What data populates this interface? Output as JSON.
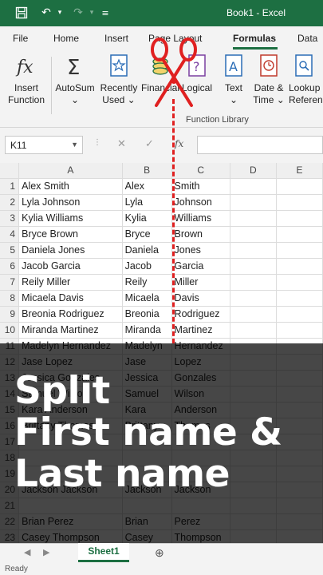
{
  "title_bar": {
    "title": "Book1  -  Excel"
  },
  "tabs": [
    {
      "label": "File",
      "active": false
    },
    {
      "label": "Home",
      "active": false
    },
    {
      "label": "Insert",
      "active": false
    },
    {
      "label": "Page Layout",
      "active": false
    },
    {
      "label": "Formulas",
      "active": true
    },
    {
      "label": "Data",
      "active": false
    }
  ],
  "ribbon": {
    "buttons": [
      {
        "line1": "Insert",
        "line2": "Function",
        "icon": "fx-icon"
      },
      {
        "line1": "AutoSum",
        "line2": "⌄",
        "icon": "sigma-icon"
      },
      {
        "line1": "Recently",
        "line2": "Used ⌄",
        "icon": "star-book-icon"
      },
      {
        "line1": "Financial",
        "line2": "",
        "icon": "coins-book-icon"
      },
      {
        "line1": "Logical",
        "line2": "",
        "icon": "question-book-icon"
      },
      {
        "line1": "Text",
        "line2": "⌄",
        "icon": "text-book-icon"
      },
      {
        "line1": "Date &",
        "line2": "Time ⌄",
        "icon": "clock-book-icon"
      },
      {
        "line1": "Lookup",
        "line2": "Reference",
        "icon": "lookup-book-icon"
      }
    ],
    "group_label": "Function Library"
  },
  "formula_bar": {
    "name_box": "K11",
    "formula": ""
  },
  "grid": {
    "columns": [
      "A",
      "B",
      "C",
      "D",
      "E"
    ],
    "rows": [
      [
        "Alex Smith",
        "Alex",
        "Smith",
        "",
        ""
      ],
      [
        "Lyla Johnson",
        "Lyla",
        "Johnson",
        "",
        ""
      ],
      [
        "Kylia Williams",
        "Kylia",
        "Williams",
        "",
        ""
      ],
      [
        "Bryce Brown",
        "Bryce",
        "Brown",
        "",
        ""
      ],
      [
        "Daniela Jones",
        "Daniela",
        "Jones",
        "",
        ""
      ],
      [
        "Jacob Garcia",
        "Jacob",
        "Garcia",
        "",
        ""
      ],
      [
        "Reily Miller",
        "Reily",
        "Miller",
        "",
        ""
      ],
      [
        "Micaela Davis",
        "Micaela",
        "Davis",
        "",
        ""
      ],
      [
        "Breonia Rodriguez",
        "Breonia",
        "Rodriguez",
        "",
        ""
      ],
      [
        "Miranda Martinez",
        "Miranda",
        "Martinez",
        "",
        ""
      ],
      [
        "Madelyn Hernandez",
        "Madelyn",
        "Hernandez",
        "",
        ""
      ],
      [
        "Jase Lopez",
        "Jase",
        "Lopez",
        "",
        ""
      ],
      [
        "Jessica Gonzales",
        "Jessica",
        "Gonzales",
        "",
        ""
      ],
      [
        "Samuel Wilson",
        "Samuel",
        "Wilson",
        "",
        ""
      ],
      [
        "Kara Anderson",
        "Kara",
        "Anderson",
        "",
        ""
      ],
      [
        "Brittany Thomas",
        "Brittany",
        "Thomas",
        "",
        ""
      ],
      [
        "",
        "",
        "",
        "",
        ""
      ],
      [
        "",
        "",
        "",
        "",
        ""
      ],
      [
        "",
        "",
        "",
        "",
        ""
      ],
      [
        "Jackson Jackson",
        "Jackson",
        "Jackson",
        "",
        ""
      ],
      [
        "",
        "",
        "",
        "",
        ""
      ],
      [
        "Brian Perez",
        "Brian",
        "Perez",
        "",
        ""
      ],
      [
        "Casey Thompson",
        "Casey",
        "Thompson",
        "",
        ""
      ]
    ]
  },
  "overlay": {
    "line1": "Split",
    "line2": "First name &",
    "line3": "Last name"
  },
  "sheet_tab": "Sheet1",
  "status": "Ready",
  "colors": {
    "excel_green": "#1d6f42",
    "split_red": "#e02020"
  }
}
